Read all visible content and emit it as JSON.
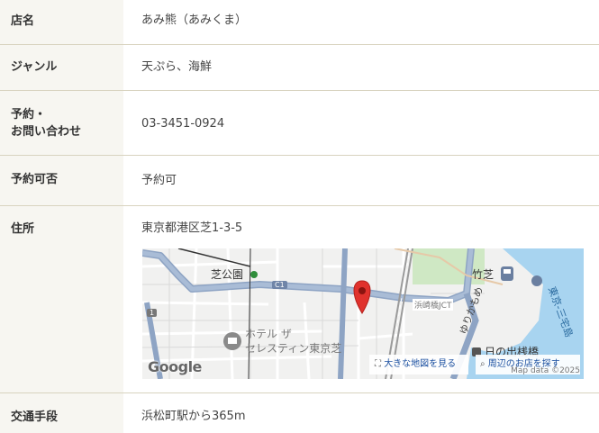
{
  "rows": [
    {
      "label": "店名",
      "value": "あみ熊（あみくま）"
    },
    {
      "label": "ジャンル",
      "value": "天ぷら、海鮮"
    },
    {
      "label_line1": "予約・",
      "label_line2": "お問い合わせ",
      "value": "03-3451-0924"
    },
    {
      "label": "予約可否",
      "value": "予約可"
    },
    {
      "label": "住所",
      "value": "東京都港区芝1-3-5"
    },
    {
      "label": "交通手段",
      "value": "浜松町駅から365m"
    }
  ],
  "map": {
    "labels": {
      "shiba_park": "芝公園",
      "hotel_line1": "ホテル ザ",
      "hotel_line2": "セレスティン東京芝",
      "takeshiba": "竹芝",
      "yurikamome": "ゆりかもめ",
      "tokyo_mita": "東京-三宅島",
      "hinode": "日の出桟橋",
      "jct": "浜崎橋JCT",
      "route_c1": "C1",
      "route_1": "1"
    },
    "large_map_button": "大きな地図を見る",
    "nearby_button": "周辺のお店を探す",
    "google_logo": "Google",
    "map_data": "Map data ©2025"
  }
}
